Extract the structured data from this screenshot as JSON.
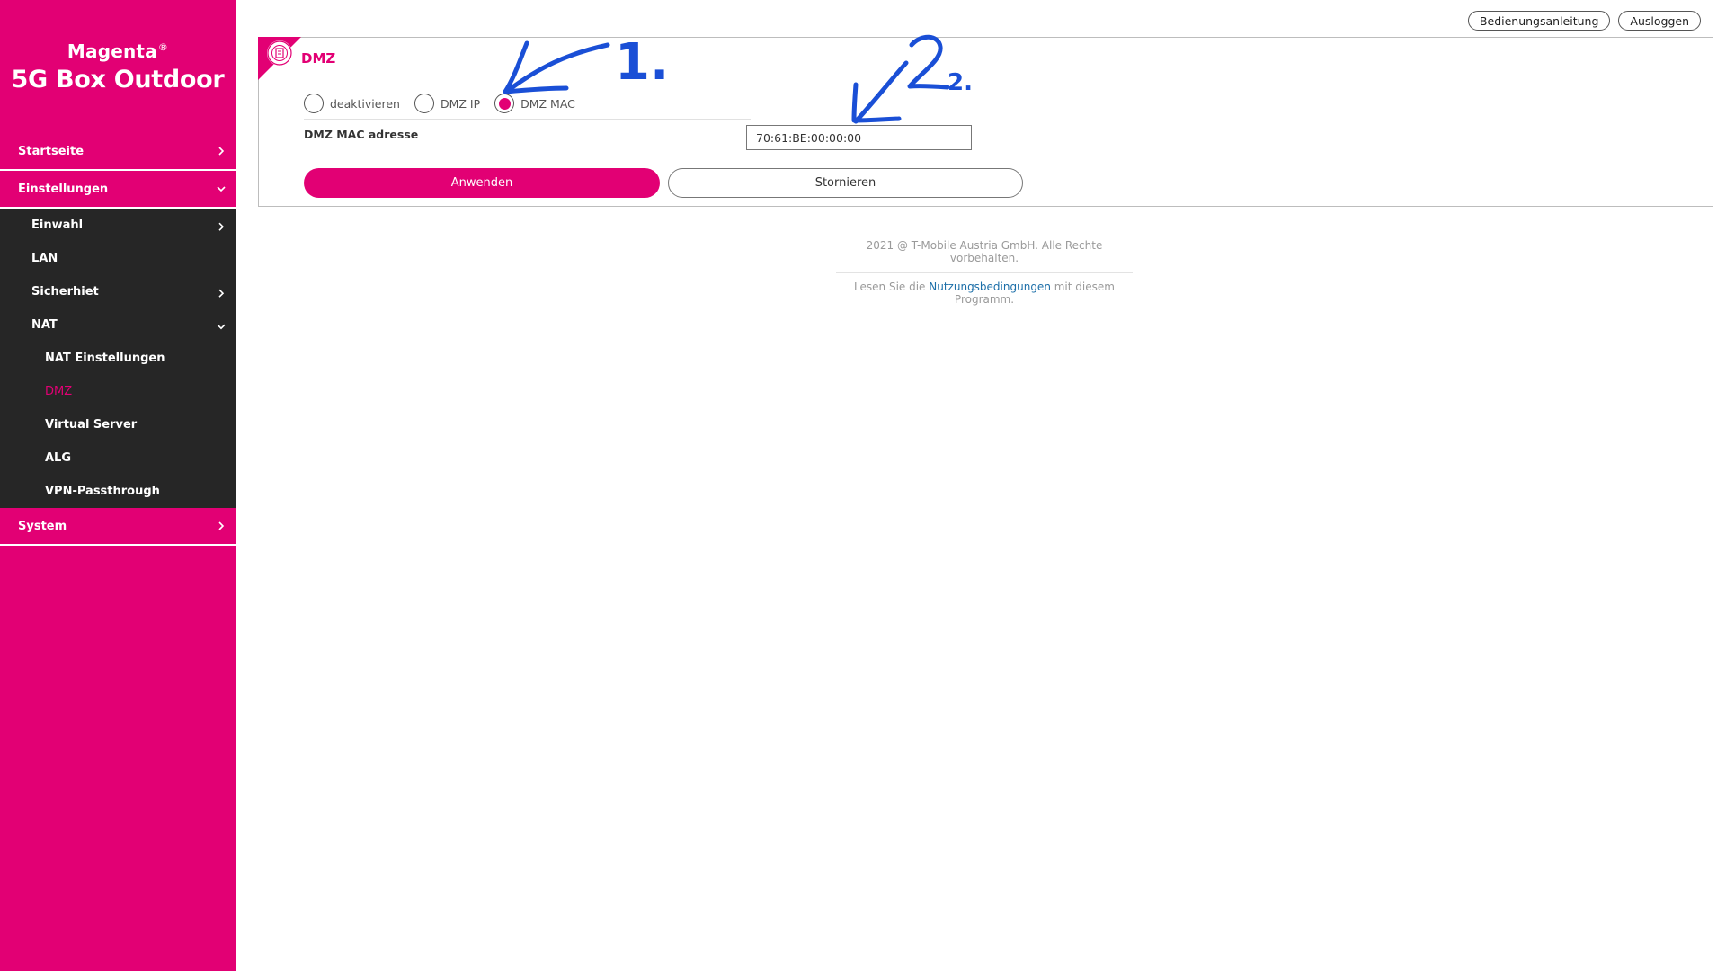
{
  "brand": {
    "top": "Magenta",
    "reg": "®",
    "main": "5G Box Outdoor"
  },
  "nav": {
    "startseite": "Startseite",
    "einstellungen": "Einstellungen",
    "einwahl": "Einwahl",
    "lan": "LAN",
    "sicherheit": "Sicherhiet",
    "nat": "NAT",
    "nat_items": [
      "NAT Einstellungen",
      "DMZ",
      "Virtual Server",
      "ALG",
      "VPN-Passthrough"
    ],
    "system": "System"
  },
  "top_actions": {
    "manual": "Bedienungsanleitung",
    "logout": "Ausloggen"
  },
  "panel": {
    "title": "DMZ",
    "radios": [
      {
        "label": "deaktivieren",
        "checked": false
      },
      {
        "label": "DMZ IP",
        "checked": false
      },
      {
        "label": "DMZ MAC",
        "checked": true
      }
    ],
    "mac_label": "DMZ MAC adresse",
    "mac_value": "70:61:BE:00:00:00",
    "apply": "Anwenden",
    "cancel": "Stornieren"
  },
  "footer": {
    "copyright": "2021 @ T-Mobile Austria GmbH. Alle Rechte vorbehalten.",
    "terms_prefix": "Lesen Sie die ",
    "terms_link": "Nutzungsbedingungen",
    "terms_suffix": " mit diesem Programm."
  },
  "annotations": {
    "one": "1.",
    "two": "2."
  },
  "colors": {
    "magenta": "#e20074",
    "dark": "#262626",
    "annotation": "#1a4fd6"
  }
}
